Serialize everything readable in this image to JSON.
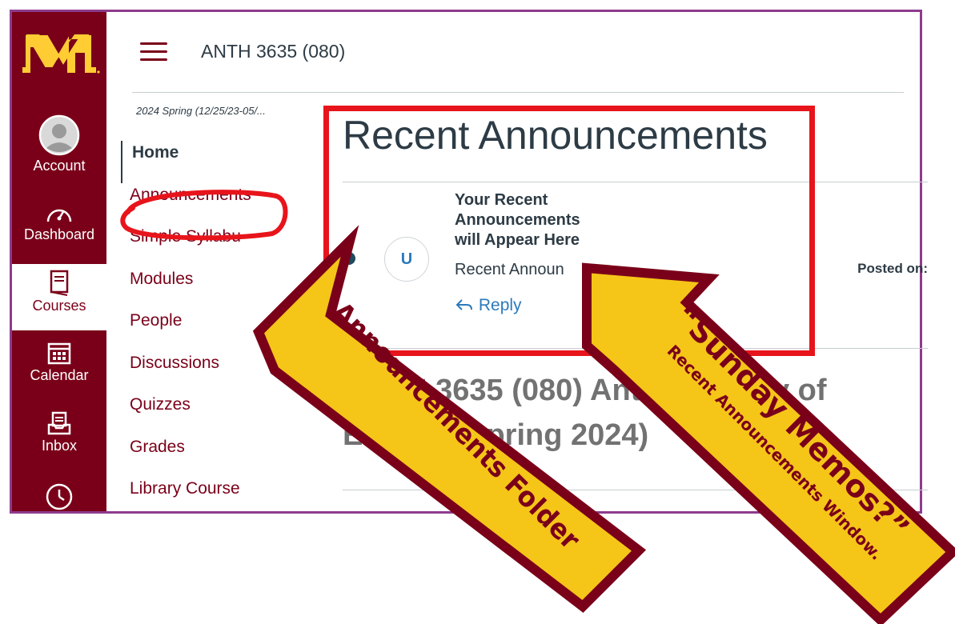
{
  "header": {
    "course_title": "ANTH 3635 (080)"
  },
  "global_nav": {
    "account": "Account",
    "dashboard": "Dashboard",
    "courses": "Courses",
    "calendar": "Calendar",
    "inbox": "Inbox"
  },
  "course_nav": {
    "term": "2024 Spring (12/25/23-05/...",
    "items": [
      {
        "label": "Home"
      },
      {
        "label": "Announcements"
      },
      {
        "label": "Simple Syllabu"
      },
      {
        "label": "Modules"
      },
      {
        "label": "People"
      },
      {
        "label": "Discussions"
      },
      {
        "label": "Quizzes"
      },
      {
        "label": "Grades"
      },
      {
        "label": "Library Course"
      }
    ]
  },
  "main": {
    "section_title": "Recent Announcements",
    "announcement": {
      "avatar_initial": "U",
      "title": "Your Recent Announcements will Appear Here",
      "title_lines": [
        "Your Recent",
        "Announcements",
        "will Appear Here"
      ],
      "body": "Recent Announ",
      "reply_label": "Reply",
      "posted_label": "Posted on:"
    },
    "page_heading_lines": [
      "ANTH 3635 (080) Anthropology of",
      "Europe (Spring 2024)"
    ]
  },
  "annotations": {
    "arrow1_label": "Announcements Folder",
    "arrow2_line1": "“Sunday Memos?”",
    "arrow2_line2": "Recent Announcements Window.",
    "colors": {
      "arrow_fill": "#f5c518",
      "arrow_border": "#7a0019",
      "highlight": "#e8141b"
    }
  }
}
